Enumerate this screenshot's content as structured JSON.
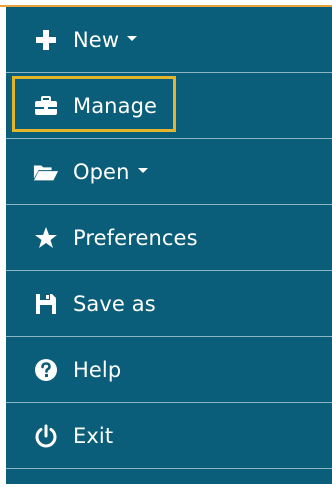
{
  "menu": {
    "items": [
      {
        "key": "new",
        "label": "New",
        "icon": "plus-icon",
        "has_caret": true
      },
      {
        "key": "manage",
        "label": "Manage",
        "icon": "briefcase-icon",
        "has_caret": false,
        "highlighted": true
      },
      {
        "key": "open",
        "label": "Open",
        "icon": "folder-open-icon",
        "has_caret": true
      },
      {
        "key": "preferences",
        "label": "Preferences",
        "icon": "star-icon",
        "has_caret": false
      },
      {
        "key": "save_as",
        "label": "Save as",
        "icon": "floppy-disk-icon",
        "has_caret": false
      },
      {
        "key": "help",
        "label": "Help",
        "icon": "question-circle-icon",
        "has_caret": false
      },
      {
        "key": "exit",
        "label": "Exit",
        "icon": "power-icon",
        "has_caret": false
      }
    ]
  },
  "colors": {
    "menu_background": "#0b5e79",
    "divider": "#8db6c4",
    "highlight_border": "#e3b52c",
    "top_accent": "#e8a33a",
    "text": "#ffffff"
  }
}
